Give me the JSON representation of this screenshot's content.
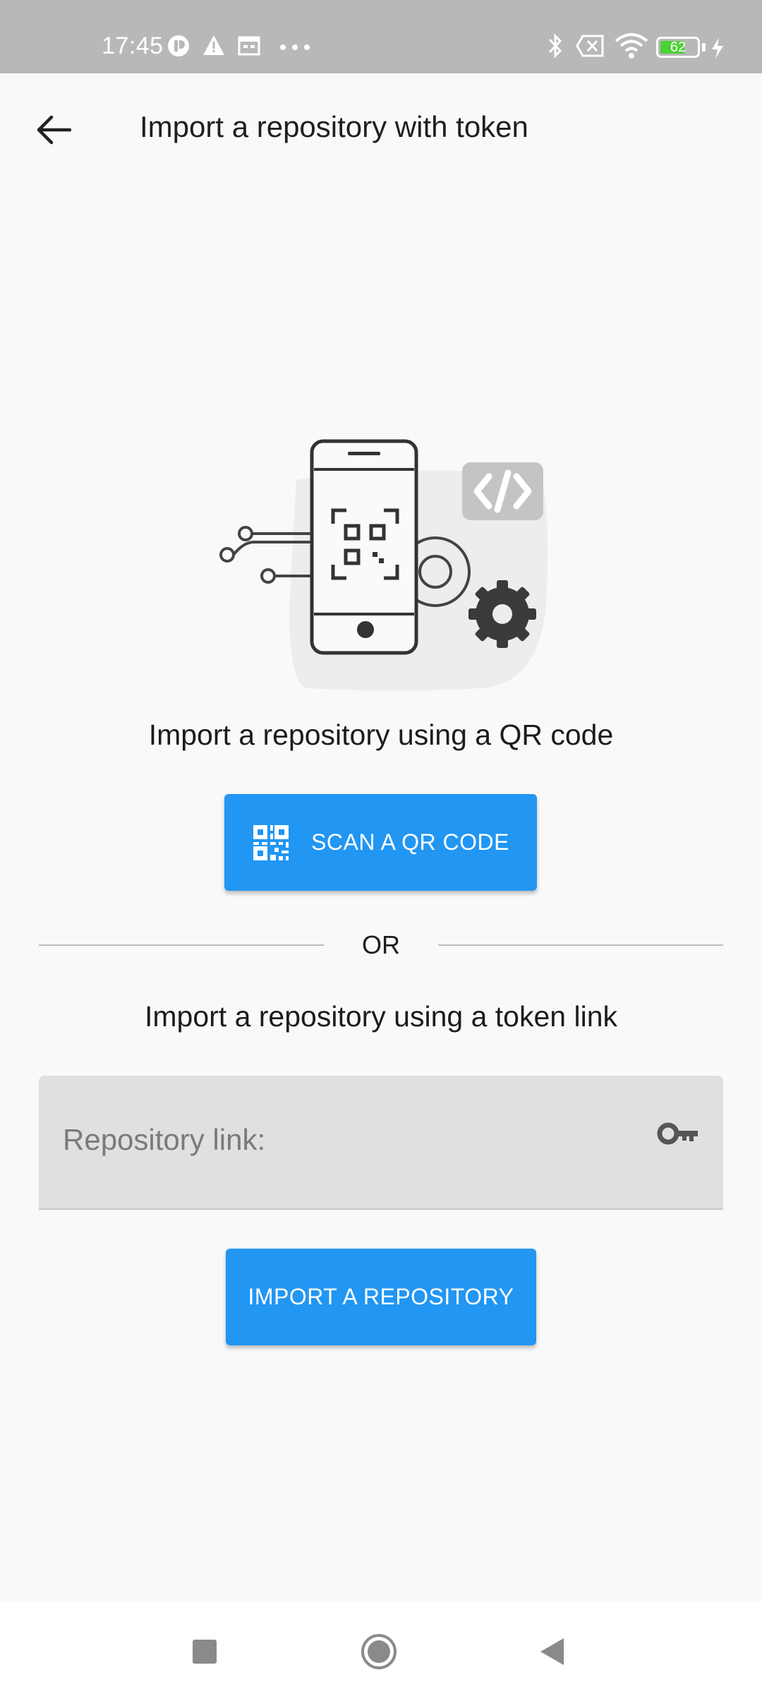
{
  "status_bar": {
    "time": "17:45",
    "battery": "62",
    "left_icons": [
      "circle-p-icon",
      "warning-icon",
      "calendar-icon",
      "more-dots-icon"
    ],
    "right_icons": [
      "bluetooth-icon",
      "x-box-icon",
      "wifi-icon",
      "battery-icon",
      "charging-icon"
    ]
  },
  "app_bar": {
    "title": "Import a repository with token",
    "back_icon": "arrow-back-icon"
  },
  "qr_section": {
    "heading": "Import a repository using a QR code",
    "button_label": "SCAN A QR CODE",
    "button_icon": "qr-code-icon"
  },
  "divider": {
    "label": "OR"
  },
  "token_section": {
    "heading": "Import a repository using a token link",
    "input_placeholder": "Repository link:",
    "input_value": "",
    "input_icon": "key-icon",
    "button_label": "IMPORT A REPOSITORY"
  },
  "nav_bar": {
    "icons": [
      "recents-square-icon",
      "home-circle-icon",
      "back-triangle-icon"
    ]
  },
  "colors": {
    "accent": "#2196f3",
    "status_bar": "#b8b8b8",
    "background": "#f9f9f9",
    "input_fill": "#e0e0e0"
  }
}
